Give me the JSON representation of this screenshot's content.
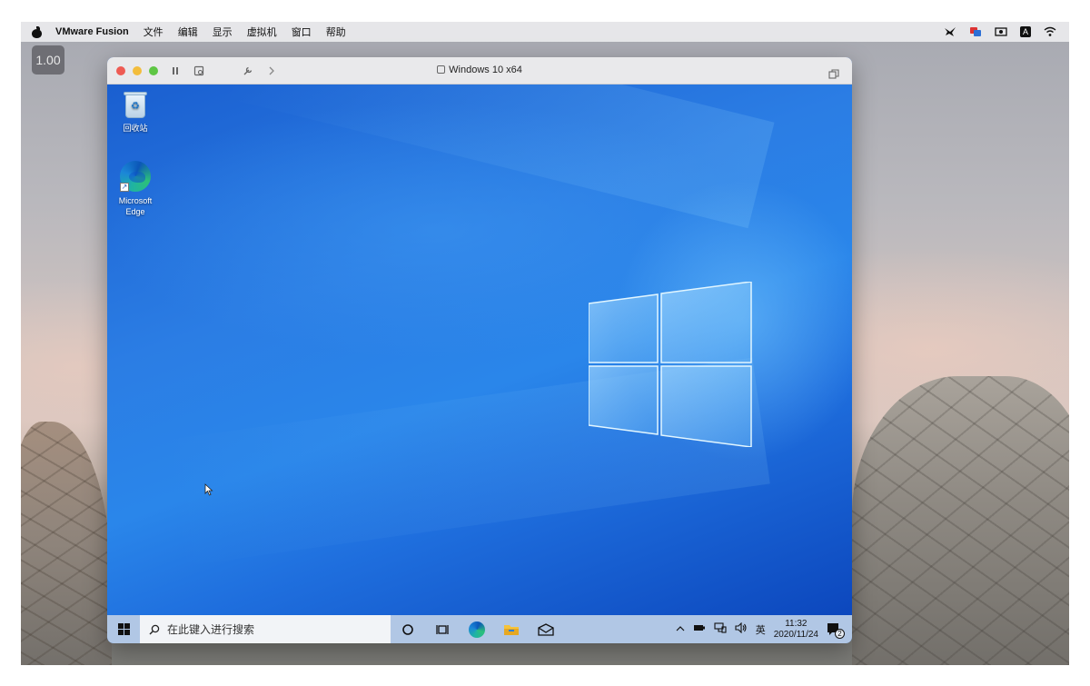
{
  "mac_menubar": {
    "app_name": "VMware Fusion",
    "menus": [
      "文件",
      "编辑",
      "显示",
      "虚拟机",
      "窗口",
      "帮助"
    ],
    "status_icons": [
      "bird-icon",
      "flag-icon",
      "screen-record-icon",
      "input-method-icon",
      "wifi-icon"
    ],
    "input_method_label": "A"
  },
  "fps_badge": "1.00",
  "vm_window": {
    "title": "Windows 10 x64",
    "toolbar": [
      "pause-icon",
      "snapshot-icon",
      "settings-wrench-icon",
      "chevron-right-icon"
    ]
  },
  "desktop": {
    "icons": [
      {
        "label": "回收站",
        "icon": "recycle-bin-icon"
      },
      {
        "label": "Microsoft Edge",
        "icon": "edge-icon"
      }
    ]
  },
  "taskbar": {
    "search_placeholder": "在此键入进行搜索",
    "pinned": [
      "cortana-icon",
      "task-view-icon",
      "edge-icon",
      "file-explorer-icon",
      "mail-icon"
    ],
    "tray": {
      "language": "英",
      "time": "11:32",
      "date": "2020/11/24",
      "notification_count": "2"
    }
  },
  "colors": {
    "desktop_blue": "#0d56c9",
    "traffic_red": "#ee5b53",
    "traffic_yellow": "#f3bd3c",
    "traffic_green": "#5ec644"
  }
}
